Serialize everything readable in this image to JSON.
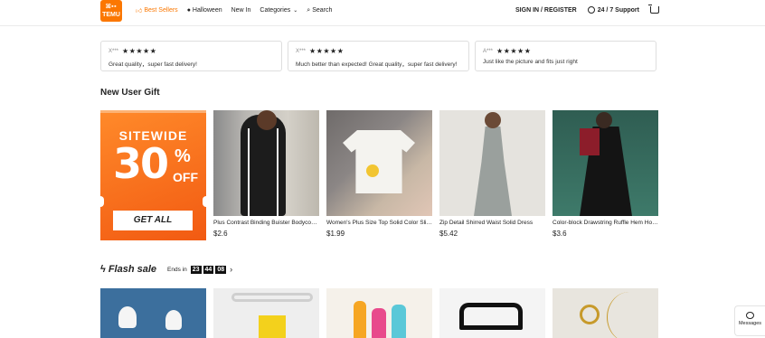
{
  "header": {
    "logo_text_top": "ꕤ▪▪",
    "logo_text": "TEMU",
    "nav": [
      {
        "label": "Best Sellers",
        "icon": "thumbs-up-icon"
      },
      {
        "label": "Halloween",
        "icon": "pumpkin-icon"
      },
      {
        "label": "New In"
      },
      {
        "label": "Categories",
        "icon": "chevron-down-icon"
      },
      {
        "label": "Search",
        "icon": "search-icon"
      }
    ],
    "sign_in": "SIGN IN / REGISTER",
    "support": "24 / 7 Support",
    "accent_color": "#fb7701"
  },
  "reviews": [
    {
      "user": "X***",
      "stars": "★★★★★",
      "text": "Great quality，super fast delivery!"
    },
    {
      "user": "X***",
      "stars": "★★★★★",
      "text": "Much better than expected! Great quality，super fast delivery!"
    },
    {
      "user": "A***",
      "stars": "★★★★★",
      "text": "Just like the picture and fits just right"
    }
  ],
  "new_user": {
    "title": "New User Gift",
    "promo": {
      "line1": "SITEWIDE",
      "pct": "30",
      "pct_sign": "%",
      "off": "OFF",
      "button": "GET ALL"
    },
    "products": [
      {
        "name": "Plus Contrast Binding Buister Bodycon Dress",
        "price": "$2.6"
      },
      {
        "name": "Women's Plus Size Top Solid Color Slim T-Shirt",
        "price": "$1.99"
      },
      {
        "name": "Zip Detail Shirred Waist Solid Dress",
        "price": "$5.42"
      },
      {
        "name": "Color-block Drawstring Ruffle Hem Hoodie Dress",
        "price": "$3.6"
      }
    ]
  },
  "flash_sale": {
    "title": "Flash sale",
    "ends_in": "Ends in",
    "hours": "23",
    "minutes": "44",
    "seconds": "08"
  },
  "messages": {
    "label": "Messages"
  }
}
